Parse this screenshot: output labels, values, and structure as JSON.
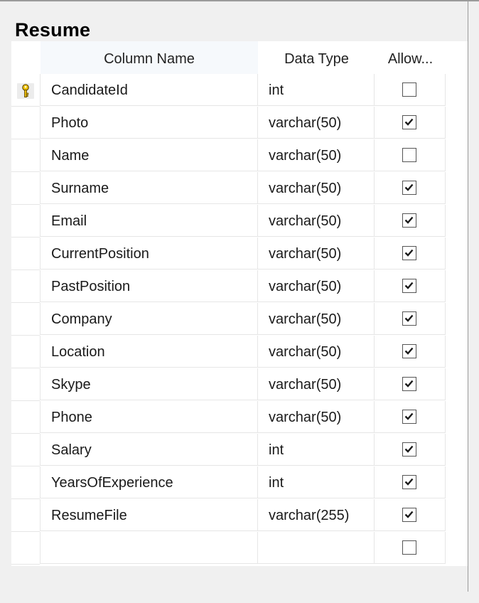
{
  "table": {
    "title": "Resume",
    "headers": {
      "column_name": "Column Name",
      "data_type": "Data Type",
      "allow_nulls": "Allow..."
    },
    "rows": [
      {
        "name": "CandidateId",
        "type": "int",
        "allow_nulls": false,
        "primary_key": true
      },
      {
        "name": "Photo",
        "type": "varchar(50)",
        "allow_nulls": true,
        "primary_key": false
      },
      {
        "name": "Name",
        "type": "varchar(50)",
        "allow_nulls": false,
        "primary_key": false
      },
      {
        "name": "Surname",
        "type": "varchar(50)",
        "allow_nulls": true,
        "primary_key": false
      },
      {
        "name": "Email",
        "type": "varchar(50)",
        "allow_nulls": true,
        "primary_key": false
      },
      {
        "name": "CurrentPosition",
        "type": "varchar(50)",
        "allow_nulls": true,
        "primary_key": false
      },
      {
        "name": "PastPosition",
        "type": "varchar(50)",
        "allow_nulls": true,
        "primary_key": false
      },
      {
        "name": "Company",
        "type": "varchar(50)",
        "allow_nulls": true,
        "primary_key": false
      },
      {
        "name": "Location",
        "type": "varchar(50)",
        "allow_nulls": true,
        "primary_key": false
      },
      {
        "name": "Skype",
        "type": "varchar(50)",
        "allow_nulls": true,
        "primary_key": false
      },
      {
        "name": "Phone",
        "type": "varchar(50)",
        "allow_nulls": true,
        "primary_key": false
      },
      {
        "name": "Salary",
        "type": "int",
        "allow_nulls": true,
        "primary_key": false
      },
      {
        "name": "YearsOfExperience",
        "type": "int",
        "allow_nulls": true,
        "primary_key": false
      },
      {
        "name": "ResumeFile",
        "type": "varchar(255)",
        "allow_nulls": true,
        "primary_key": false
      },
      {
        "name": "",
        "type": "",
        "allow_nulls": false,
        "primary_key": false
      }
    ]
  },
  "icons": {
    "primary_key": "key-icon",
    "checkbox": "checkbox-icon"
  },
  "colors": {
    "background": "#f0f0f0",
    "grid": "#ffffff",
    "key": "#e8b400"
  }
}
